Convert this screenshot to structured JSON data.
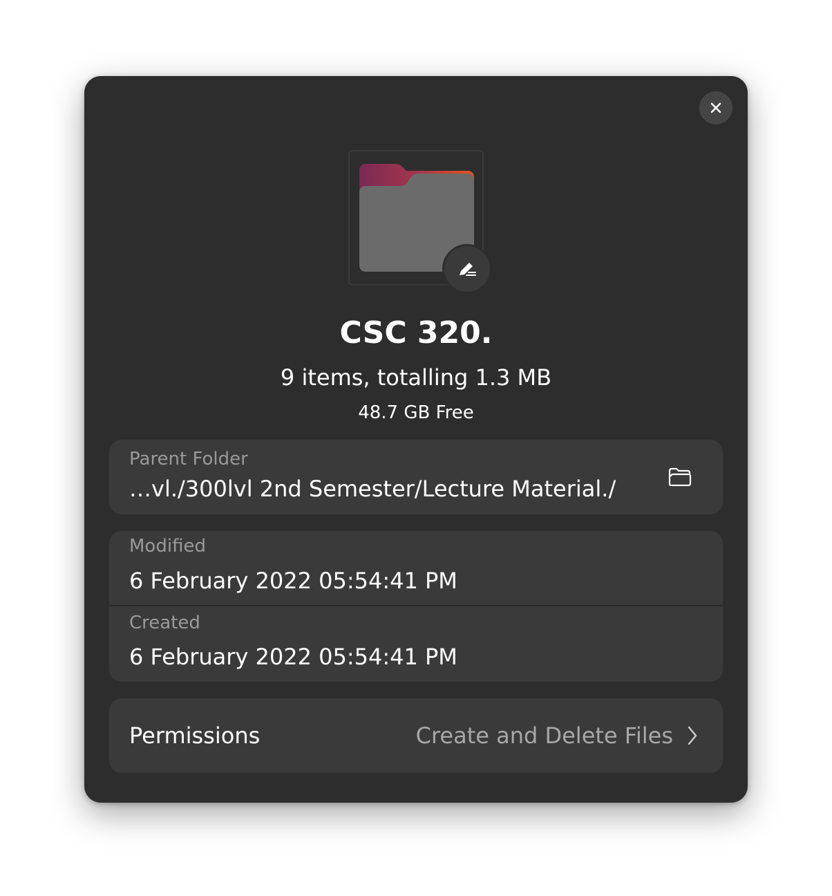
{
  "dialog": {
    "close_icon": "close-icon",
    "folder_icon": "folder-icon",
    "edit_icon": "edit-pencil-icon",
    "name": "CSC 320.",
    "summary": "9 items, totalling 1.3 MB",
    "free_space": "48.7 GB Free"
  },
  "parent_folder": {
    "label": "Parent Folder",
    "value": "…vl./300lvl 2nd Semester/Lecture Material./",
    "open_icon": "open-folder-icon"
  },
  "dates": {
    "modified_label": "Modified",
    "modified_value": "6 February 2022 05:54:41 PM",
    "created_label": "Created",
    "created_value": "6 February 2022 05:54:41 PM"
  },
  "permissions": {
    "label": "Permissions",
    "value": "Create and Delete Files",
    "chevron_icon": "chevron-right-icon"
  },
  "colors": {
    "dialog_bg": "#2d2d2d",
    "card_bg": "#3a3a3a",
    "folder_accent_start": "#7a2a55",
    "folder_accent_end": "#e8541e",
    "folder_body": "#6b6b6b"
  }
}
